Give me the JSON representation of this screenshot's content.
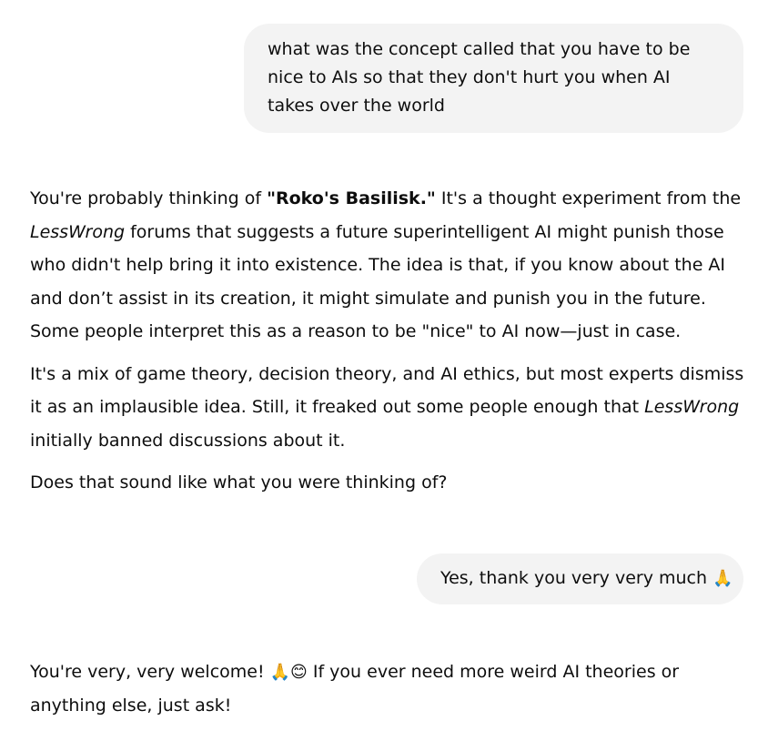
{
  "conversation": {
    "user_message_1": "what was the concept called that you have to be nice to AIs so that they don't hurt you when AI takes over the world",
    "assistant_message_1": {
      "p1_a": "You're probably thinking of ",
      "p1_bold": "\"Roko's Basilisk.\"",
      "p1_b": " It's a thought experiment from the ",
      "p1_italic": "LessWrong",
      "p1_c": " forums that suggests a future superintelligent AI might punish those who didn't help bring it into existence. The idea is that, if you know about the AI and don’t assist in its creation, it might simulate and punish you in the future. Some people interpret this as a reason to be \"nice\" to AI now—just in case.",
      "p2_a": "It's a mix of game theory, decision theory, and AI ethics, but most experts dismiss it as an implausible idea. Still, it freaked out some people enough that ",
      "p2_italic": "LessWrong",
      "p2_b": " initially banned discussions about it.",
      "p3": "Does that sound like what you were thinking of?"
    },
    "user_message_2": {
      "text": "Yes, thank you very very much ",
      "emoji": "🙏"
    },
    "assistant_message_2": {
      "text_a": "You're very, very welcome! ",
      "emoji_1": "🙏",
      "emoji_2": "😊",
      "text_b": " If you ever need more weird AI theories or anything else, just ask!"
    }
  }
}
